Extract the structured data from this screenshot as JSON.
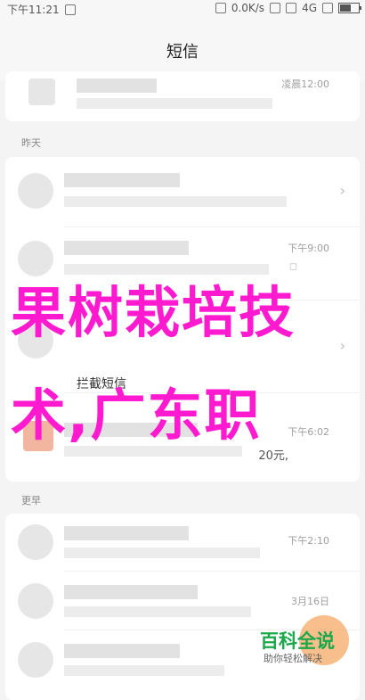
{
  "status_bar": {
    "time": "下午11:21",
    "network_speed": "0.0K/s",
    "network_type": "4G"
  },
  "header": {
    "title": "短信"
  },
  "sections": {
    "yesterday": "昨天",
    "earlier": "更早"
  },
  "messages": [
    {
      "meta": "凌晨12:00"
    },
    {
      "meta": ""
    },
    {
      "meta": "下午9:00"
    },
    {
      "meta": ""
    },
    {
      "meta": ""
    },
    {
      "meta": "下午6:02"
    },
    {
      "meta": "下午2:10"
    },
    {
      "meta": "3月16日"
    },
    {
      "meta": ""
    }
  ],
  "labels": {
    "intercepted": "拦截短信",
    "amount": "20元,"
  },
  "overlay": {
    "line1": "果树栽培技",
    "line2": "术,广东职"
  },
  "watermark": {
    "brand": "百科全说",
    "slogan": "助你轻松解决"
  },
  "icons": {
    "chevron": "›",
    "bubble": "◻"
  }
}
